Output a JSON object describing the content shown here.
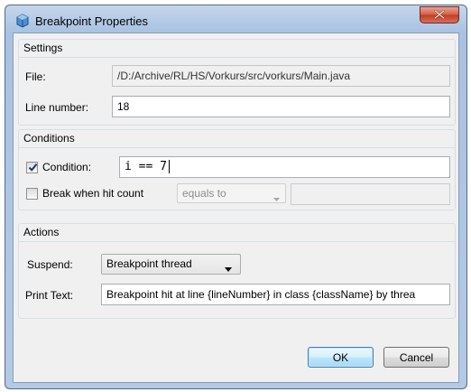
{
  "window": {
    "title": "Breakpoint Properties",
    "close_label": "X"
  },
  "settings": {
    "title": "Settings",
    "file_label": "File:",
    "file_value": "/D:/Archive/RL/HS/Vorkurs/src/vorkurs/Main.java",
    "line_label": "Line number:",
    "line_value": "18"
  },
  "conditions": {
    "title": "Conditions",
    "condition_checked": true,
    "condition_label": "Condition:",
    "condition_value": "i == 7",
    "hitcount_checked": false,
    "hitcount_label": "Break when hit count",
    "hitcount_operator": "equals to",
    "hitcount_value": ""
  },
  "actions": {
    "title": "Actions",
    "suspend_label": "Suspend:",
    "suspend_value": "Breakpoint thread",
    "print_label": "Print Text:",
    "print_value": "Breakpoint hit at line {lineNumber} in class {className} by threa"
  },
  "buttons": {
    "ok": "OK",
    "cancel": "Cancel"
  },
  "colors": {
    "accent": "#3c7fb1",
    "close": "#c23a20"
  }
}
